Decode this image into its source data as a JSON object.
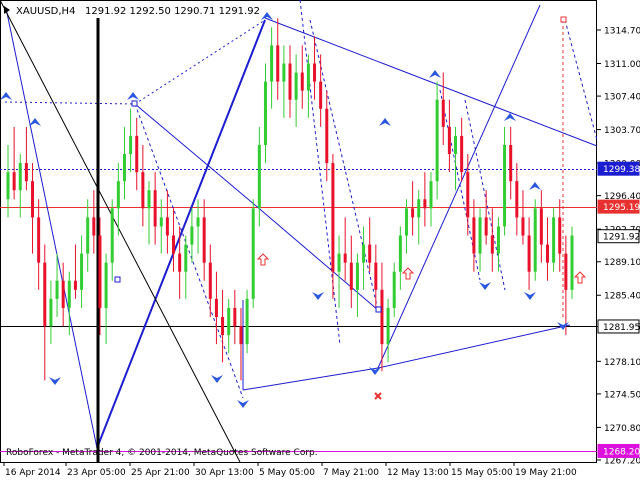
{
  "header": {
    "symbol": "XAUUSD,H4",
    "ohlc": "1291.92 1292.50 1290.71 1291.92"
  },
  "footer": {
    "credit": "RoboForex - MetaTrader 4, © 2001-2014, MetaQuotes Software Corp."
  },
  "colors": {
    "bull": "#32cd32",
    "bear": "#e8102a",
    "line": "#1c1cd0",
    "red_level": "#e83030",
    "magenta": "#dd11dd",
    "axis_text": "#000000"
  },
  "chart_data": {
    "type": "candlestick",
    "symbol": "XAUUSD",
    "timeframe": "H4",
    "y_ticks": [
      1314.7,
      1311.0,
      1307.4,
      1303.7,
      1300.0,
      1296.4,
      1292.7,
      1289.1,
      1285.4,
      1281.95,
      1278.1,
      1274.5,
      1270.8,
      1267.2
    ],
    "x_labels": [
      "16 Apr 2014",
      "23 Apr 05:00",
      "25 Apr 21:00",
      "30 Apr 13:00",
      "5 May 05:00",
      "7 May 21:00",
      "12 May 13:00",
      "15 May 05:00",
      "19 May 21:00"
    ],
    "price_tags": [
      {
        "value": 1299.38,
        "color": "#1c1cd0"
      },
      {
        "value": 1295.19,
        "color": "#e83030"
      },
      {
        "value": 1291.92,
        "color": "#000000"
      },
      {
        "value": 1281.95,
        "color": "#000000"
      },
      {
        "value": 1268.2,
        "color": "#dd11dd"
      }
    ],
    "horizontal_levels": [
      {
        "value": 1299.38,
        "style": "dotted",
        "color": "#1c1cd0"
      },
      {
        "value": 1295.19,
        "style": "solid",
        "color": "#e83030"
      },
      {
        "value": 1281.95,
        "style": "solid",
        "color": "#000000"
      },
      {
        "value": 1268.2,
        "style": "solid",
        "color": "#dd11dd"
      }
    ],
    "candles": [
      [
        1296,
        1302,
        1294,
        1299
      ],
      [
        1299,
        1304,
        1296,
        1297
      ],
      [
        1297,
        1301,
        1294,
        1300
      ],
      [
        1300,
        1304,
        1297,
        1298
      ],
      [
        1298,
        1300,
        1290,
        1294
      ],
      [
        1294,
        1296,
        1286,
        1289
      ],
      [
        1289,
        1291,
        1276,
        1282
      ],
      [
        1282,
        1287,
        1280,
        1285
      ],
      [
        1285,
        1290,
        1283,
        1287
      ],
      [
        1287,
        1289,
        1282,
        1284
      ],
      [
        1284,
        1288,
        1281,
        1287
      ],
      [
        1287,
        1291,
        1285,
        1286
      ],
      [
        1286,
        1292,
        1284,
        1290
      ],
      [
        1290,
        1296,
        1288,
        1294
      ],
      [
        1294,
        1297,
        1290,
        1292
      ],
      [
        1292,
        1294,
        1281,
        1284
      ],
      [
        1284,
        1290,
        1280,
        1289
      ],
      [
        1289,
        1296,
        1287,
        1295
      ],
      [
        1295,
        1300,
        1292,
        1298
      ],
      [
        1298,
        1304,
        1296,
        1301
      ],
      [
        1301,
        1306,
        1299,
        1303
      ],
      [
        1303,
        1305,
        1297,
        1299
      ],
      [
        1299,
        1302,
        1293,
        1295
      ],
      [
        1295,
        1298,
        1291,
        1297
      ],
      [
        1297,
        1299,
        1291,
        1293
      ],
      [
        1293,
        1296,
        1290,
        1294
      ],
      [
        1294,
        1297,
        1290,
        1292
      ],
      [
        1292,
        1295,
        1288,
        1290
      ],
      [
        1290,
        1293,
        1285,
        1288
      ],
      [
        1288,
        1292,
        1285,
        1291
      ],
      [
        1291,
        1295,
        1289,
        1293
      ],
      [
        1293,
        1296,
        1290,
        1294
      ],
      [
        1294,
        1296,
        1287,
        1289
      ],
      [
        1289,
        1291,
        1283,
        1285
      ],
      [
        1285,
        1288,
        1280,
        1283
      ],
      [
        1283,
        1286,
        1278,
        1281
      ],
      [
        1281,
        1285,
        1279,
        1284
      ],
      [
        1284,
        1286,
        1280,
        1282
      ],
      [
        1282,
        1284,
        1276,
        1280
      ],
      [
        1280,
        1286,
        1279,
        1285
      ],
      [
        1285,
        1296,
        1284,
        1295
      ],
      [
        1295,
        1304,
        1293,
        1302
      ],
      [
        1302,
        1311,
        1300,
        1309
      ],
      [
        1309,
        1315,
        1306,
        1313
      ],
      [
        1313,
        1316,
        1307,
        1309
      ],
      [
        1309,
        1313,
        1305,
        1311
      ],
      [
        1311,
        1313,
        1305,
        1307
      ],
      [
        1307,
        1312,
        1304,
        1310
      ],
      [
        1310,
        1313,
        1306,
        1308
      ],
      [
        1308,
        1312,
        1305,
        1311
      ],
      [
        1311,
        1314,
        1307,
        1309
      ],
      [
        1309,
        1312,
        1304,
        1306
      ],
      [
        1306,
        1308,
        1298,
        1300
      ],
      [
        1300,
        1301,
        1285,
        1288
      ],
      [
        1288,
        1292,
        1284,
        1290
      ],
      [
        1290,
        1294,
        1287,
        1289
      ],
      [
        1289,
        1292,
        1284,
        1286
      ],
      [
        1286,
        1290,
        1283,
        1289
      ],
      [
        1289,
        1293,
        1286,
        1291
      ],
      [
        1291,
        1294,
        1288,
        1289
      ],
      [
        1289,
        1291,
        1284,
        1286
      ],
      [
        1286,
        1289,
        1277,
        1280
      ],
      [
        1280,
        1285,
        1278,
        1284
      ],
      [
        1284,
        1289,
        1283,
        1288
      ],
      [
        1288,
        1293,
        1286,
        1292
      ],
      [
        1292,
        1296,
        1290,
        1295
      ],
      [
        1295,
        1298,
        1292,
        1294
      ],
      [
        1294,
        1297,
        1291,
        1296
      ],
      [
        1296,
        1299,
        1293,
        1295
      ],
      [
        1295,
        1299,
        1293,
        1298
      ],
      [
        1298,
        1309,
        1296,
        1307
      ],
      [
        1307,
        1310,
        1302,
        1304
      ],
      [
        1304,
        1307,
        1299,
        1301
      ],
      [
        1301,
        1304,
        1297,
        1303
      ],
      [
        1303,
        1305,
        1298,
        1299
      ],
      [
        1299,
        1301,
        1292,
        1294
      ],
      [
        1294,
        1296,
        1288,
        1290
      ],
      [
        1290,
        1295,
        1288,
        1294
      ],
      [
        1294,
        1297,
        1291,
        1292
      ],
      [
        1292,
        1295,
        1288,
        1290
      ],
      [
        1290,
        1294,
        1288,
        1293
      ],
      [
        1293,
        1304,
        1292,
        1302
      ],
      [
        1302,
        1304,
        1296,
        1298
      ],
      [
        1298,
        1300,
        1292,
        1294
      ],
      [
        1294,
        1297,
        1291,
        1292
      ],
      [
        1292,
        1294,
        1286,
        1288
      ],
      [
        1288,
        1296,
        1287,
        1295
      ],
      [
        1295,
        1297,
        1289,
        1291
      ],
      [
        1291,
        1294,
        1287,
        1289
      ],
      [
        1289,
        1295,
        1288,
        1294
      ],
      [
        1294,
        1296,
        1288,
        1290
      ],
      [
        1290,
        1292,
        1281,
        1286
      ],
      [
        1286,
        1293,
        1285,
        1292
      ]
    ]
  }
}
